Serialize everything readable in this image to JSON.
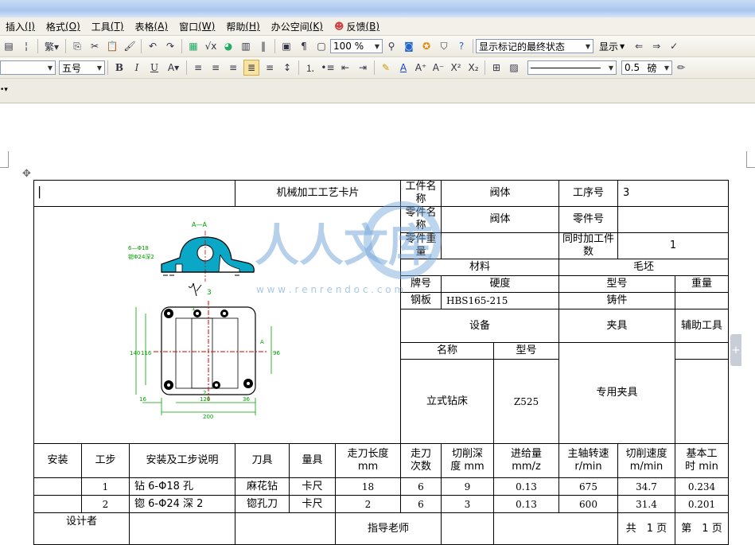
{
  "menus": [
    {
      "label": "插入",
      "key": "(I)"
    },
    {
      "label": "格式",
      "key": "(O)"
    },
    {
      "label": "工具",
      "key": "(T)"
    },
    {
      "label": "表格",
      "key": "(A)"
    },
    {
      "label": "窗口",
      "key": "(W)"
    },
    {
      "label": "帮助",
      "key": "(H)"
    },
    {
      "label": "办公空间",
      "key": "(K)"
    },
    {
      "label": "反馈",
      "key": "(B)"
    }
  ],
  "toolbar1": {
    "zoom": "100 %",
    "track_mode": "显示标记的最终状态",
    "show_label": "显示"
  },
  "toolbar2": {
    "font_size": "五号",
    "line_width": "0.5",
    "line_unit": "磅"
  },
  "watermark": {
    "text_cn": "人人文库",
    "url": "w w w . r e n r e n d o c . c o m"
  },
  "colors": {
    "accent": "#2f5fa7",
    "watermark": "#6fa3d8",
    "drawing_green": "#00a000",
    "drawing_cyan": "#00a0c0",
    "drawing_red": "#e00000"
  },
  "drawing": {
    "section_label": "A—A",
    "hole_note_1": "6—Φ18",
    "hole_note_2": "锪Φ24深2",
    "roughness_mark": "3",
    "dim_140": "140",
    "dim_116": "116",
    "dim_96": "96",
    "dim_120": "120",
    "dim_16": "16",
    "dim_36": "36",
    "dim_200": "200",
    "mark_1": "1",
    "mark_2": "2",
    "mark_A": "A"
  },
  "card": {
    "title": "机械加工工艺卡片",
    "workpiece_name_label": "工件名称",
    "workpiece_name": "阀体",
    "process_no_label": "工序号",
    "process_no": "3",
    "part_name_label": "零件名称",
    "part_name": "阀体",
    "part_no_label": "零件号",
    "part_no": "",
    "part_weight_label": "零件重量",
    "part_weight": "",
    "simul_count_label": "同时加工件数",
    "simul_count": "1",
    "material_label": "材料",
    "blank_label": "毛坯",
    "grade_label": "牌号",
    "hardness_label": "硬度",
    "type_label": "型号",
    "weight_label": "重量",
    "grade": "钢板",
    "hardness": "HBS165-215",
    "blank_type": "铸件",
    "blank_weight": "",
    "equipment_label": "设备",
    "fixture_label": "夹具",
    "aux_tool_label": "辅助工具",
    "eq_name_label": "名称",
    "eq_model_label": "型号",
    "eq_name": "立式钻床",
    "eq_model": "Z525",
    "fixture": "专用夹具",
    "headers": {
      "install": "安装",
      "step": "工步",
      "desc": "安装及工步说明",
      "tool": "刀具",
      "gauge": "量具",
      "feed_len": "走刀长度",
      "feed_len_unit": "mm",
      "passes": "走刀",
      "passes2": "次数",
      "depth": "切削深",
      "depth_unit": "度 mm",
      "feed": "进给量",
      "feed_unit": "mm/z",
      "spindle": "主轴转速",
      "spindle_unit": "r/min",
      "speed": "切削速度",
      "speed_unit": "m/min",
      "time": "基本工",
      "time_unit": "时 min"
    },
    "rows": [
      {
        "install": "",
        "step": "1",
        "desc": "钻 6-Φ18 孔",
        "tool": "麻花钻",
        "gauge": "卡尺",
        "feed_len": "18",
        "passes": "6",
        "depth": "9",
        "feed": "0.13",
        "spindle": "675",
        "speed": "34.7",
        "time": "0.234"
      },
      {
        "install": "",
        "step": "2",
        "desc": "锪 6-Φ24 深 2",
        "tool": "锪孔刀",
        "gauge": "卡尺",
        "feed_len": "2",
        "passes": "6",
        "depth": "3",
        "feed": "0.13",
        "spindle": "600",
        "speed": "31.4",
        "time": "0.201"
      }
    ],
    "designer_label": "设计者",
    "advisor_label": "指导老师",
    "total_pages": "共　1 页",
    "page_no": "第　1 页"
  }
}
